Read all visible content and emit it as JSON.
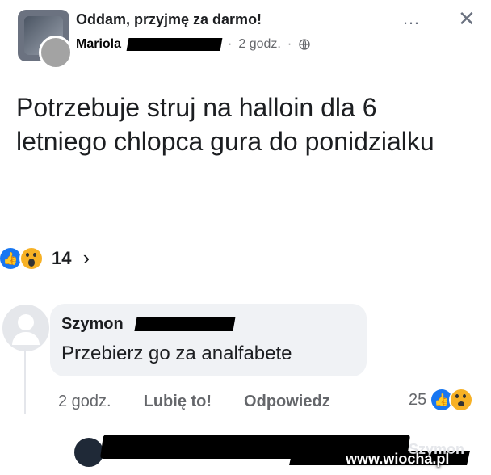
{
  "header": {
    "group_title": "Oddam, przyjmę za darmo!",
    "author_name": "Mariola",
    "time": "2 godz.",
    "dot": "·",
    "more_icon": "…",
    "close_icon": "✕"
  },
  "post": {
    "text": "Potrzebuje struj na halloin dla 6 letniego chlopca gura do ponidzialku"
  },
  "reactions": {
    "count": "14",
    "chevron": "›"
  },
  "comment": {
    "name": "Szymon",
    "text": "Przebierz go za analfabete",
    "actions": {
      "time": "2 godz.",
      "like": "Lubię to!",
      "reply": "Odpowiedz"
    },
    "reaction_count": "25"
  },
  "reply": {
    "name": "Szymon",
    "watermark": "www.wiocha.pl"
  },
  "colors": {
    "primary_blue": "#1877f2",
    "text": "#1c1e21",
    "muted": "#65676b",
    "bubble": "#f0f2f5"
  },
  "icons": {
    "globe": "globe-icon",
    "like": "like-reaction-icon",
    "wow": "wow-reaction-icon",
    "haha": "haha-reaction-icon"
  }
}
